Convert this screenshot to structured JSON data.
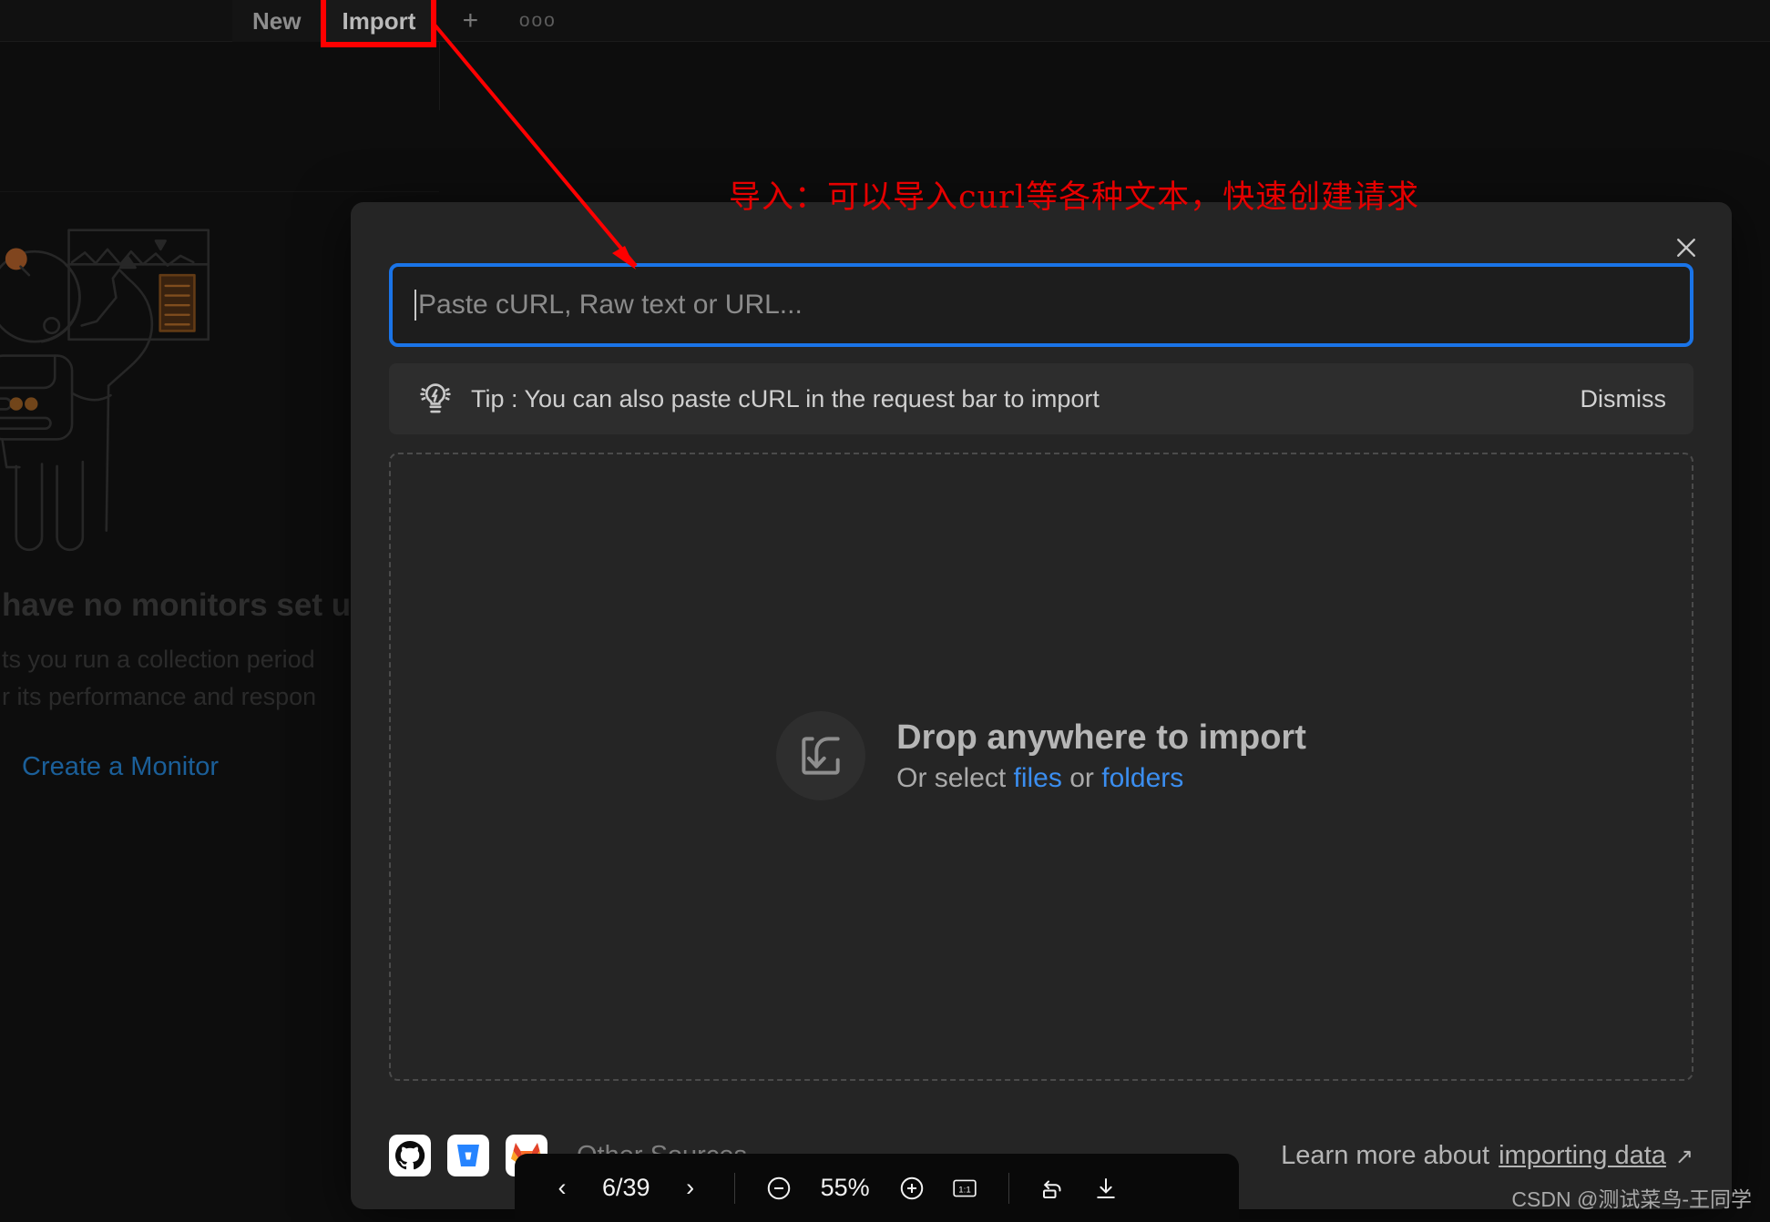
{
  "app": {
    "tabs": [
      {
        "label": "New",
        "name": "tab-new"
      },
      {
        "label": "Import",
        "name": "tab-import"
      }
    ],
    "add_tab_icon": "plus-icon",
    "more_icon": "ellipsis-icon",
    "more_glyph": "ooo",
    "plus_glyph": "+"
  },
  "empty_state": {
    "title": "have no monitors set up",
    "body_line1": "ts you run a collection period",
    "body_line2": "r its performance and respon",
    "link": "Create a Monitor",
    "illustration": "astronaut-monitoring-illustration"
  },
  "annotation": {
    "text": "导入：可以导入curl等各种文本，快速创建请求",
    "color": "#e50000",
    "highlight_target": "Import",
    "box_color": "#ff0000"
  },
  "modal": {
    "name": "import-modal",
    "close_icon": "close-icon",
    "input": {
      "placeholder": "Paste cURL, Raw text or URL...",
      "value": "",
      "focus_color": "#1a74e8"
    },
    "tip": {
      "icon": "lightbulb-idea-icon",
      "text": "Tip : You can also paste cURL in the request bar to import",
      "dismiss_label": "Dismiss"
    },
    "dropzone": {
      "icon": "import-arrow-icon",
      "headline": "Drop anywhere to import",
      "sub_prefix": "Or select ",
      "files_label": "files",
      "sub_middle": " or ",
      "folders_label": "folders",
      "link_color": "#3b8ef0"
    },
    "footer": {
      "sources": [
        {
          "name": "github-icon",
          "label": "GitHub"
        },
        {
          "name": "bitbucket-icon",
          "label": "Bitbucket"
        },
        {
          "name": "gitlab-icon",
          "label": "GitLab"
        }
      ],
      "other_sources_label": "Other Sources",
      "chevron": "⌄",
      "learn_prefix": "Learn more about ",
      "learn_link": "importing data",
      "external_arrow": "↗"
    }
  },
  "pdf_toolbar": {
    "prev_glyph": "‹",
    "next_glyph": "›",
    "page_indicator": "6/39",
    "zoom_out_icon": "zoom-out-icon",
    "zoom_level": "55%",
    "zoom_in_icon": "zoom-in-icon",
    "fit_icon": "actual-size-icon",
    "fit_glyph": "1:1",
    "rotate_icon": "rotate-icon",
    "download_icon": "download-icon"
  },
  "watermark": {
    "text": "CSDN @测试菜鸟-王同学"
  }
}
